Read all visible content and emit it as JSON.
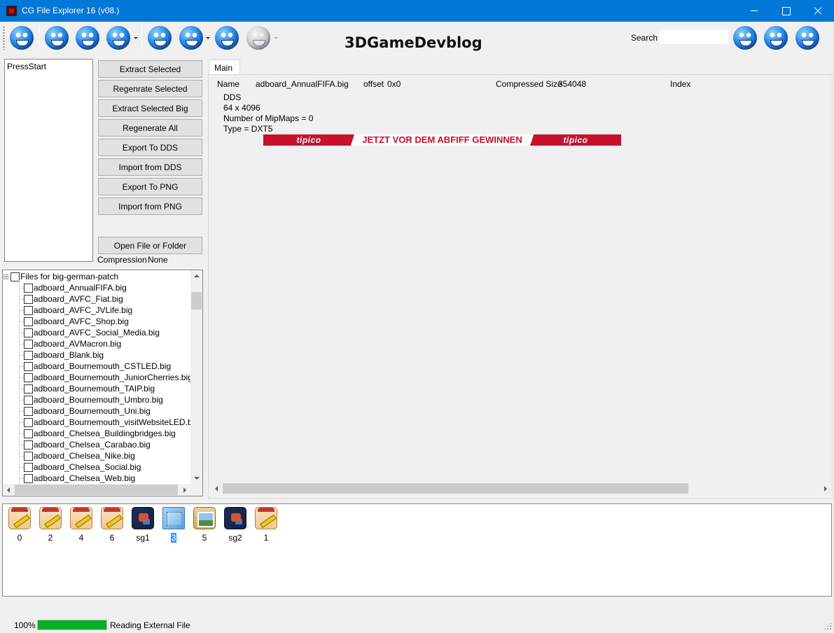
{
  "window": {
    "title": "CG File Explorer 16 (v08.)"
  },
  "toolbar": {
    "search_label": "Search",
    "search_value": "",
    "logo_text": "3DGameDevblog",
    "left_buttons": [
      "smiley-icon",
      "smiley-icon",
      "smiley-icon",
      "smiley-icon",
      "smiley-icon",
      "smiley-icon",
      "smiley-icon",
      "smiley-icon"
    ],
    "right_buttons": [
      "smiley-icon",
      "smiley-icon",
      "smiley-icon"
    ]
  },
  "entries_list": {
    "items": [
      "PressStart"
    ]
  },
  "actions": {
    "extract_selected": "Extract Selected",
    "regenerate_selected": "Regenrate Selected",
    "extract_selected_big": "Extract Selected Big",
    "regenerate_all": "Regenerate All",
    "export_dds": "Export To DDS",
    "import_dds": "Import from DDS",
    "export_png": "Export To PNG",
    "import_png": "Import from PNG",
    "open_file": "Open File or Folder"
  },
  "compression": {
    "label": "Compression",
    "value": "None"
  },
  "file_tree": {
    "root": "Files for big-german-patch",
    "files": [
      "adboard_AnnualFIFA.big",
      "adboard_AVFC_Fiat.big",
      "adboard_AVFC_JVLife.big",
      "adboard_AVFC_Shop.big",
      "adboard_AVFC_Social_Media.big",
      "adboard_AVMacron.big",
      "adboard_Blank.big",
      "adboard_Bournemouth_CSTLED.big",
      "adboard_Bournemouth_JuniorCherries.big",
      "adboard_Bournemouth_TAIP.big",
      "adboard_Bournemouth_Umbro.big",
      "adboard_Bournemouth_Uni.big",
      "adboard_Bournemouth_visitWebsiteLED.big",
      "adboard_Chelsea_Buildingbridges.big",
      "adboard_Chelsea_Carabao.big",
      "adboard_Chelsea_Nike.big",
      "adboard_Chelsea_Social.big",
      "adboard_Chelsea_Web.big"
    ]
  },
  "main_tab": {
    "label": "Main",
    "name_label": "Name",
    "name_value": "adboard_AnnualFIFA.big",
    "offset_label": "offset",
    "offset_value": "0x0",
    "compressed_label": "Compressed Size",
    "compressed_value": "354048",
    "index_label": "Index",
    "info_lines": [
      "DDS",
      "64 x 4096",
      "Number of MipMaps = 0",
      "Type = DXT5"
    ],
    "preview": {
      "left": "tipico",
      "middle": "JETZT VOR DEM ABFIFF GEWINNEN",
      "right": "tipico",
      "brand_color": "#c8102e"
    }
  },
  "thumbnails": [
    {
      "label": "0",
      "icon": "pencil-icon"
    },
    {
      "label": "2",
      "icon": "pencil-icon"
    },
    {
      "label": "4",
      "icon": "pencil-icon"
    },
    {
      "label": "6",
      "icon": "pencil-icon"
    },
    {
      "label": "sg1",
      "icon": "game-icon"
    },
    {
      "label": "3",
      "icon": "image-icon",
      "selected": true
    },
    {
      "label": "5",
      "icon": "picture-icon"
    },
    {
      "label": "sg2",
      "icon": "game-icon"
    },
    {
      "label": "1",
      "icon": "pencil-icon"
    }
  ],
  "status": {
    "percent_text": "100%",
    "progress": 1.0,
    "message": "Reading External File",
    "progress_color": "#06b025"
  },
  "colors": {
    "titlebar": "#0078d7",
    "selection": "#3399ff"
  }
}
